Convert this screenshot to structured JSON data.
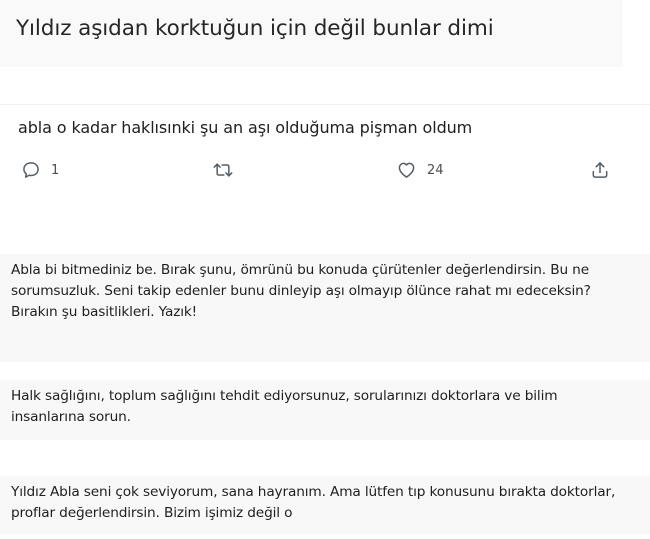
{
  "header": {
    "title": "Yıldız aşıdan korktuğun için değil bunlar dimi"
  },
  "tweet": {
    "text": "abla o kadar haklısınki şu an aşı olduğuma pişman oldum",
    "actions": {
      "reply_count": "1",
      "like_count": "24"
    },
    "icons": [
      "reply-icon",
      "retweet-icon",
      "like-icon",
      "share-icon"
    ]
  },
  "comments": [
    {
      "text": "Abla bi bitmediniz be. Bırak şunu, ömrünü bu konuda çürütenler değerlendirsin. Bu ne sorumsuzluk. Seni takip edenler bunu dinleyip aşı olmayıp ölünce rahat mı edeceksin? Bırakın şu basitlikleri. Yazık!"
    },
    {
      "text": "Halk sağlığını, toplum sağlığını tehdit ediyorsunuz, sorularınızı doktorlara ve bilim insanlarına sorun."
    },
    {
      "text": "Yıldız Abla seni çok seviyorum, sana hayranım. Ama lütfen tıp konusunu bırakta doktorlar, proflar değerlendirsin. Bizim işimiz değil o"
    }
  ]
}
